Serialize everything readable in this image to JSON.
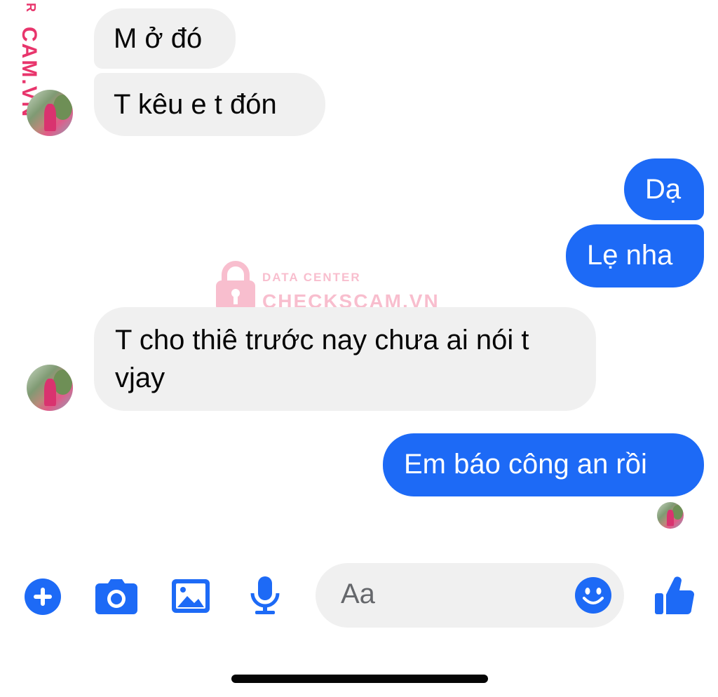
{
  "watermark": {
    "side_letter": "R",
    "side_text": "CAM.VN",
    "center_line1": "DATA CENTER",
    "center_line2": "CHECKSCAM.VN"
  },
  "messages": [
    {
      "direction": "incoming",
      "text": "M ở đó"
    },
    {
      "direction": "incoming",
      "text": "T kêu e t đón"
    },
    {
      "direction": "outgoing",
      "text": "Dạ"
    },
    {
      "direction": "outgoing",
      "text": "Lẹ nha"
    },
    {
      "direction": "incoming",
      "text": "T cho thiê trước nay chưa ai nói t vjay"
    },
    {
      "direction": "outgoing",
      "text": "Em báo công an rồi"
    }
  ],
  "composer": {
    "placeholder": "Aa",
    "icons": [
      "plus-icon",
      "camera-icon",
      "image-icon",
      "microphone-icon",
      "emoji-icon",
      "thumbs-up-icon"
    ]
  },
  "colors": {
    "accent": "#1d6af6",
    "incoming_bubble": "#f0f0f0",
    "watermark": "#e8356c"
  }
}
